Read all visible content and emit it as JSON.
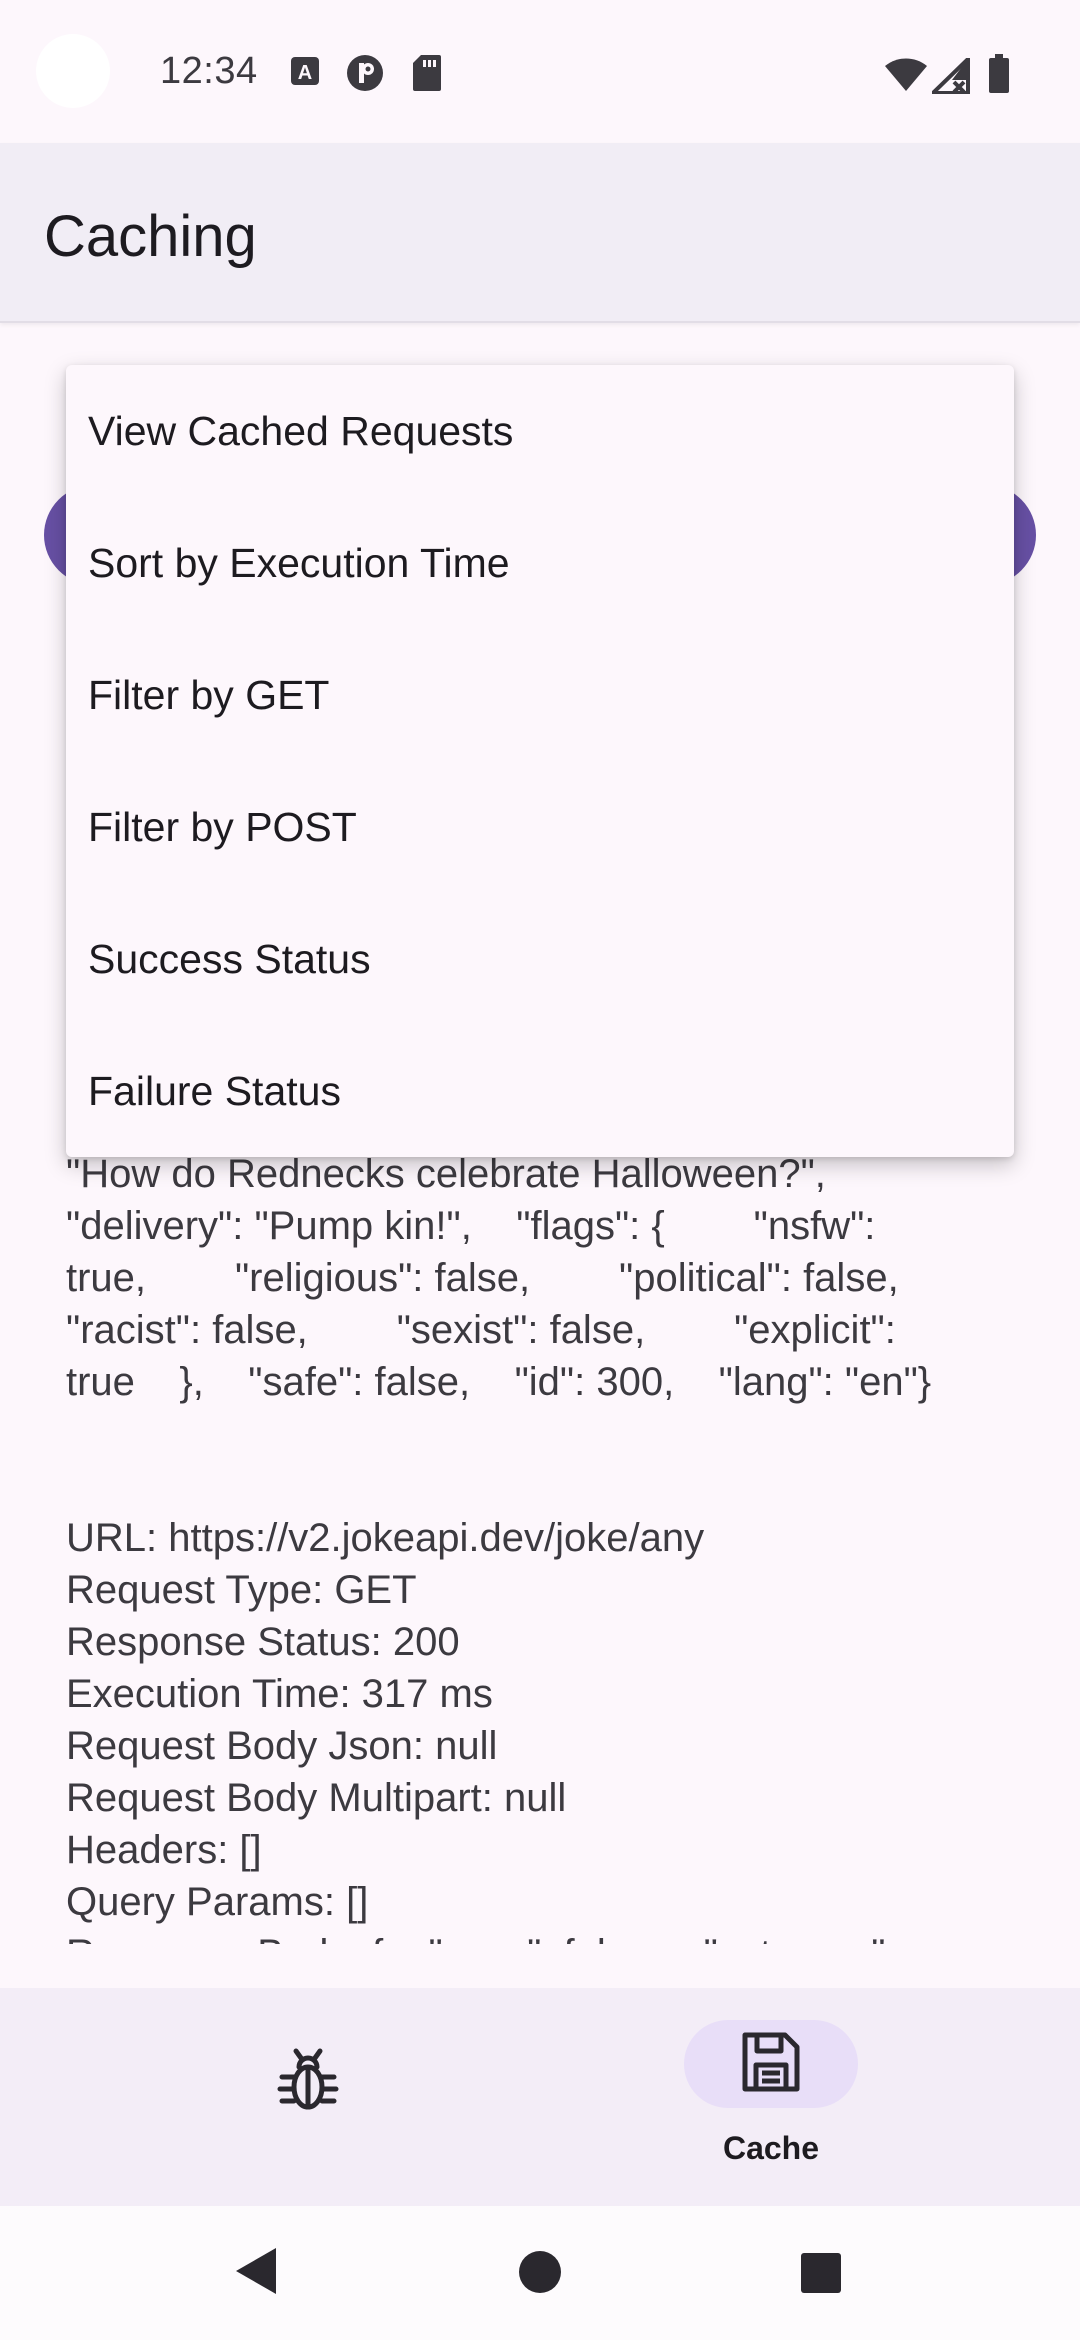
{
  "status_bar": {
    "time": "12:34",
    "left_icons": [
      "text-a-icon",
      "p-circle-icon",
      "sd-card-icon"
    ],
    "right_icons": [
      "wifi-icon",
      "cellular-no-signal-icon",
      "battery-icon"
    ]
  },
  "app_bar": {
    "title": "Caching"
  },
  "menu": {
    "items": [
      "View Cached Requests",
      "Sort by Execution Time",
      "Filter by GET",
      "Filter by POST",
      "Success Status",
      "Failure Status"
    ]
  },
  "content": {
    "log_block_1": "\"How do Rednecks celebrate Halloween?\",\n\"delivery\": \"Pump kin!\",    \"flags\": {        \"nsfw\":\ntrue,        \"religious\": false,        \"political\": false,\n\"racist\": false,        \"sexist\": false,        \"explicit\":\ntrue    },    \"safe\": false,    \"id\": 300,    \"lang\": \"en\"}",
    "log_block_2": "URL: https://v2.jokeapi.dev/joke/any\nRequest Type: GET\nResponse Status: 200\nExecution Time: 317 ms\nRequest Body Json: null\nRequest Body Multipart: null\nHeaders: []\nQuery Params: []\nResponse Body: {    \"error\": false,    \"category\":"
  },
  "bottom_nav": {
    "debug_icon": "bug-icon",
    "cache_icon": "save-icon",
    "cache_label": "Cache",
    "selected": "Cache"
  },
  "system_nav": {
    "icons": [
      "back-icon",
      "home-icon",
      "recents-icon"
    ]
  },
  "colors": {
    "background": "#fdf7fc",
    "app_bar": "#f1edf5",
    "primary": "#6750a4",
    "nav_indicator": "#e8def8",
    "text": "#1d1b20"
  }
}
